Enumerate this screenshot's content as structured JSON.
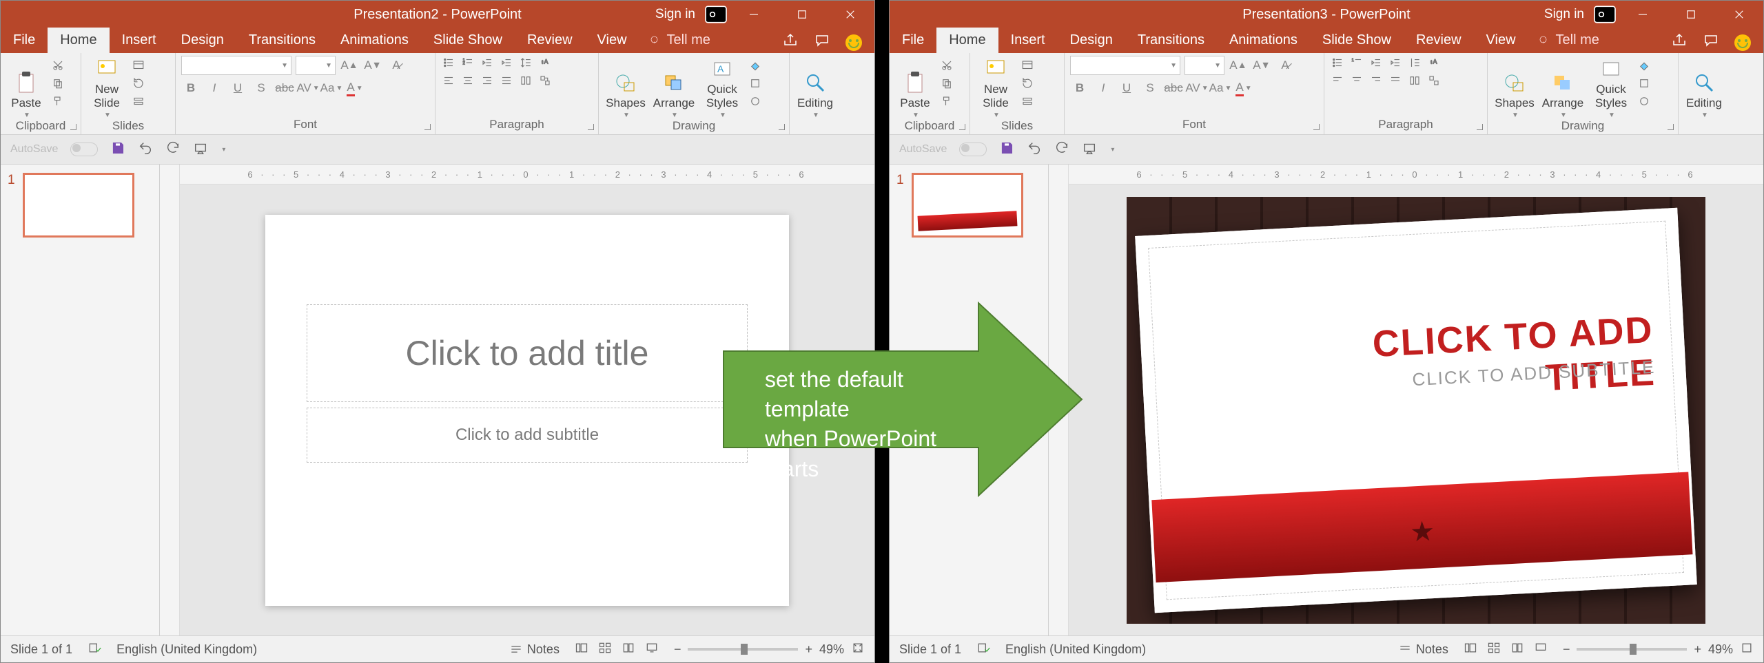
{
  "left": {
    "title": "Presentation2  -  PowerPoint",
    "signin": "Sign in",
    "tabs": {
      "file": "File",
      "home": "Home",
      "insert": "Insert",
      "design": "Design",
      "transitions": "Transitions",
      "animations": "Animations",
      "slideshow": "Slide Show",
      "review": "Review",
      "view": "View",
      "tell": "Tell me"
    },
    "ribbon": {
      "clipboard": {
        "paste": "Paste",
        "cap": "Clipboard"
      },
      "slides": {
        "new": "New\nSlide",
        "cap": "Slides"
      },
      "font": {
        "cap": "Font"
      },
      "paragraph": {
        "cap": "Paragraph"
      },
      "drawing": {
        "shapes": "Shapes",
        "arrange": "Arrange",
        "quick": "Quick\nStyles",
        "cap": "Drawing"
      },
      "editing": {
        "cap": "Editing",
        "label": "Editing"
      }
    },
    "qat": {
      "autosave": "AutoSave"
    },
    "ruler": "6 · · · 5 · · · 4 · · · 3 · · · 2 · · · 1 · · · 0 · · · 1 · · · 2 · · · 3 · · · 4 · · · 5 · · · 6",
    "thumb_num": "1",
    "slide": {
      "title": "Click to add title",
      "subtitle": "Click to add subtitle"
    },
    "status": {
      "slide": "Slide 1 of 1",
      "lang": "English (United Kingdom)",
      "notes": "Notes",
      "zoom": "49%"
    }
  },
  "right": {
    "title": "Presentation3  -  PowerPoint",
    "signin": "Sign in",
    "tabs": {
      "file": "File",
      "home": "Home",
      "insert": "Insert",
      "design": "Design",
      "transitions": "Transitions",
      "animations": "Animations",
      "slideshow": "Slide Show",
      "review": "Review",
      "view": "View",
      "tell": "Tell me"
    },
    "ribbon": {
      "clipboard": {
        "paste": "Paste",
        "cap": "Clipboard"
      },
      "slides": {
        "new": "New\nSlide",
        "cap": "Slides"
      },
      "font": {
        "cap": "Font"
      },
      "paragraph": {
        "cap": "Paragraph"
      },
      "drawing": {
        "shapes": "Shapes",
        "arrange": "Arrange",
        "quick": "Quick\nStyles",
        "cap": "Drawing"
      },
      "editing": {
        "cap": "Editing",
        "label": "Editing"
      }
    },
    "qat": {
      "autosave": "AutoSave"
    },
    "ruler": "6 · · · 5 · · · 4 · · · 3 · · · 2 · · · 1 · · · 0 · · · 1 · · · 2 · · · 3 · · · 4 · · · 5 · · · 6",
    "thumb_num": "1",
    "slide": {
      "title": "CLICK TO ADD TITLE",
      "subtitle": "CLICK TO ADD SUBTITLE"
    },
    "status": {
      "slide": "Slide 1 of 1",
      "lang": "English (United Kingdom)",
      "notes": "Notes",
      "zoom": "49%"
    }
  },
  "arrow": {
    "line1": "set the default template",
    "line2": "when PowerPoint starts"
  }
}
